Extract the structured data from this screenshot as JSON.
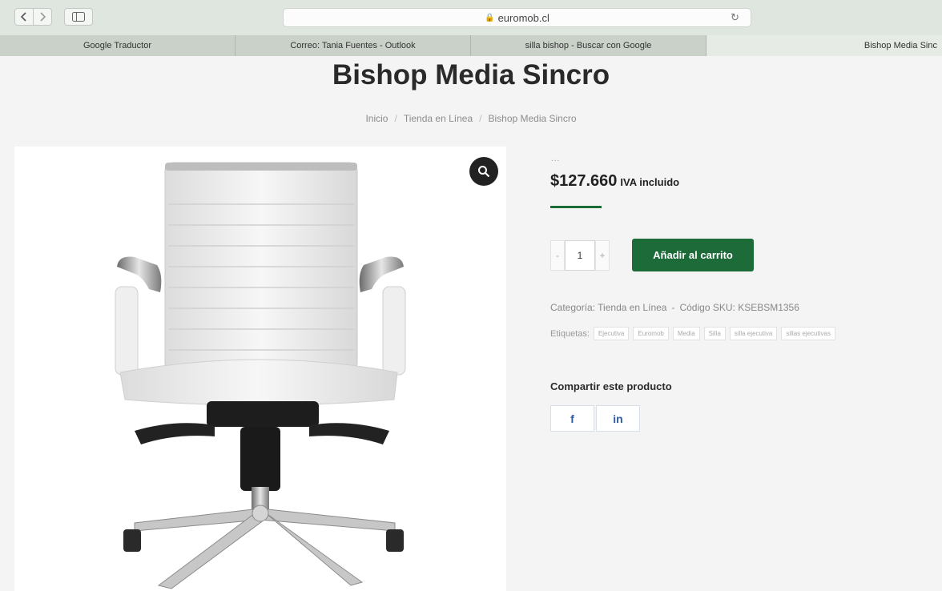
{
  "browser": {
    "url": "euromob.cl",
    "tabs": [
      {
        "label": "Google Traductor"
      },
      {
        "label": "Correo: Tania Fuentes - Outlook"
      },
      {
        "label": "silla bishop - Buscar con Google"
      },
      {
        "label": "Bishop Media Sinc"
      }
    ]
  },
  "product": {
    "title": "Bishop Media Sincro",
    "breadcrumb": [
      "Inicio",
      "Tienda en Línea",
      "Bishop Media Sincro"
    ],
    "dots": "...",
    "price": "$127.660",
    "price_suffix": "IVA incluido",
    "quantity": "1",
    "qty_minus": "-",
    "qty_plus": "+",
    "add_to_cart": "Añadir al carrito",
    "category_label": "Categoría:",
    "category": "Tienda en Línea",
    "sku_label": "Código SKU:",
    "sku": "KSEBSM1356",
    "tags_label": "Etiquetas:",
    "tags": [
      "Ejecutiva",
      "Euromob",
      "Media",
      "Silla",
      "silla ejecutiva",
      "sillas ejecutivas"
    ],
    "share_title": "Compartir este producto",
    "share": {
      "facebook": "f",
      "linkedin": "in"
    }
  },
  "colors": {
    "brand": "#1c6b39",
    "social": "#2e5aa6"
  }
}
